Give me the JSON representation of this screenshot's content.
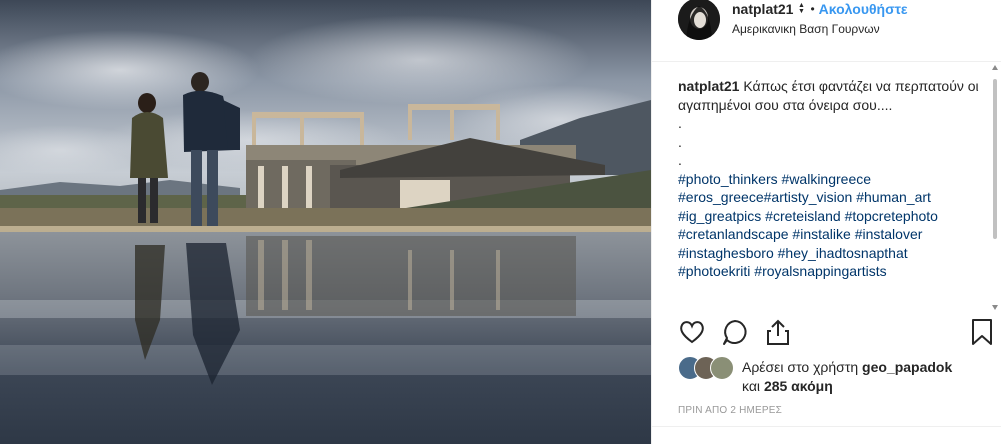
{
  "post": {
    "username": "natplat21",
    "follow_label": "Ακολουθήστε",
    "location": "Αμερικανικη Βαση Γουρνων",
    "caption_user": "natplat21",
    "caption_text": "Κάπως έτσι φαντάζει να περπατούν οι αγαπημένοι σου στα όνειρα σου....",
    "dots": [
      ".",
      ".",
      "."
    ],
    "hashtags": [
      "#photo_thinkers",
      "#walkingreece",
      "#eros_greece",
      "#artisty_vision",
      "#human_art",
      "#ig_greatpics",
      "#creteisland",
      "#topcretephoto",
      "#cretanlandscape",
      "#instalike",
      "#instalover",
      "#instaghesboro",
      "#hey_ihadtosnapthat",
      "#photoekriti",
      "#royalsnappingartists"
    ],
    "likes_prefix": "Αρέσει στο χρήστη",
    "likes_user": "geo_papadok",
    "likes_and": "και",
    "likes_count": "285 ακόμη",
    "timestamp": "ΠΡΙΝ ΑΠΟ 2 ΗΜΕΡΕΣ"
  },
  "icons": {
    "like": "heart-icon",
    "comment": "comment-icon",
    "share": "share-icon",
    "save": "bookmark-icon"
  },
  "colors": {
    "accent": "#3897f0",
    "hashtag": "#003569",
    "timestamp": "#999999"
  }
}
